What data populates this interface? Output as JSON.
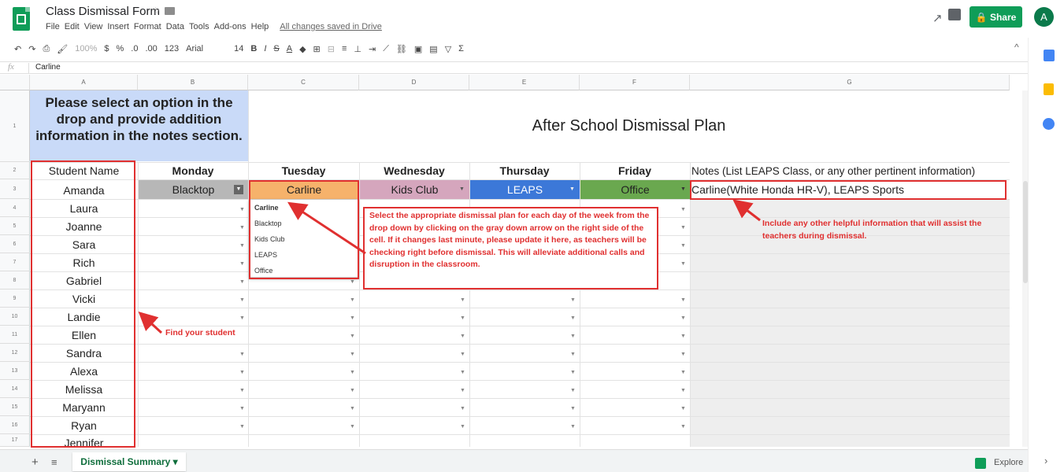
{
  "header": {
    "title": "Class Dismissal Form",
    "star_icon": "star-icon",
    "folder_icon": "folder-icon",
    "menu": [
      "File",
      "Edit",
      "View",
      "Insert",
      "Format",
      "Data",
      "Tools",
      "Add-ons",
      "Help"
    ],
    "saved_status": "All changes saved in Drive",
    "share_label": "Share",
    "avatar_initial": "A"
  },
  "toolbar": {
    "zoom": "100%",
    "currency": "$",
    "percent": "%",
    "decimals_less": ".0",
    "decimals_more": ".00",
    "format": "123",
    "font": "Arial",
    "font_size": "14",
    "bold": "B",
    "italic": "I",
    "strike": "S",
    "textcolor": "A",
    "sigma": "Σ"
  },
  "formula_bar": {
    "fx": "fx",
    "value": "Carline"
  },
  "columns": [
    "A",
    "B",
    "C",
    "D",
    "E",
    "F",
    "G"
  ],
  "rows": [
    "1",
    "2",
    "3",
    "4",
    "5",
    "6",
    "7",
    "8",
    "9",
    "10",
    "11",
    "12",
    "13",
    "14",
    "15",
    "16",
    "17"
  ],
  "sheet": {
    "instructions": "Please select an option in the drop and provide addition information in the notes section.",
    "plan_title": "After School Dismissal Plan",
    "headers": {
      "student": "Student Name",
      "mon": "Monday",
      "tue": "Tuesday",
      "wed": "Wednesday",
      "thu": "Thursday",
      "fri": "Friday",
      "notes": "Notes (List LEAPS Class, or any other pertinent information)"
    },
    "first_row": {
      "mon": "Blacktop",
      "tue": "Carline",
      "wed": "Kids Club",
      "thu": "LEAPS",
      "fri": "Office",
      "notes": "Carline(White Honda HR-V), LEAPS Sports"
    },
    "students": [
      "Amanda",
      "Laura",
      "Joanne",
      "Sara",
      "Rich",
      "Gabriel",
      "Vicki",
      "Landie",
      "Ellen",
      "Sandra",
      "Alexa",
      "Melissa",
      "Maryann",
      "Ryan",
      "Jennifer"
    ],
    "colors": {
      "blacktop": "#b7b7b7",
      "carline": "#f6b26b",
      "kids_club": "#d5a6bd",
      "leaps": "#3c78d8",
      "office": "#6aa84f",
      "instructions_bg": "#c9daf8",
      "annotation": "#e03030"
    }
  },
  "dropdown": {
    "options": [
      "Carline",
      "Blacktop",
      "Kids Club",
      "LEAPS",
      "Office"
    ]
  },
  "annotations": {
    "find": "Find your student",
    "select": "Select the appropriate dismissal plan for each  day of the week from the drop down by clicking on the gray down arrow on the right side of the cell. If it changes last minute, please update it here, as teachers will be checking right before dismissal. This will alleviate additional calls and disruption in the classroom.",
    "include": "Include any other helpful information that will assist the teachers during dismissal."
  },
  "bottom": {
    "add": "+",
    "list": "≡",
    "sheet_tab": "Dismissal Summary",
    "explore": "Explore"
  }
}
